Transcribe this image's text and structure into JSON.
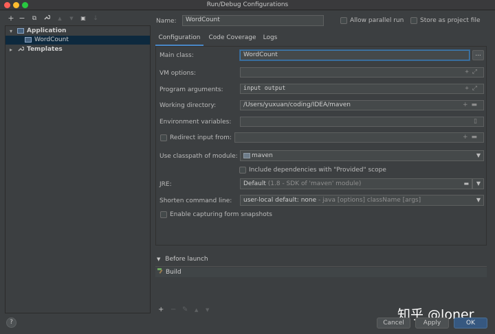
{
  "window": {
    "title": "Run/Debug Configurations"
  },
  "left_toolbar": {
    "add_icon": "+",
    "remove_icon": "−",
    "copy_icon": "⧉",
    "edit_icon": "🔧",
    "up_icon": "▲",
    "down_icon": "▼",
    "folder_icon": "▣",
    "sort_icon": "↓"
  },
  "tree": {
    "items": [
      {
        "label": "Application",
        "expanded": true
      },
      {
        "label": "WordCount",
        "selected": true
      },
      {
        "label": "Templates",
        "expanded": false
      }
    ]
  },
  "header": {
    "name_label": "Name:",
    "name_value": "WordCount",
    "allow_parallel_label": "Allow parallel run",
    "store_as_file_label": "Store as project file"
  },
  "tabs": [
    {
      "label": "Configuration",
      "active": true
    },
    {
      "label": "Code Coverage",
      "active": false
    },
    {
      "label": "Logs",
      "active": false
    }
  ],
  "form": {
    "main_class_label": "Main class:",
    "main_class_value": "WordCount",
    "main_class_button": "...",
    "vm_options_label": "VM options:",
    "vm_options_value": "",
    "program_args_label": "Program arguments:",
    "program_args_value": "input output",
    "working_dir_label": "Working directory:",
    "working_dir_value": "/Users/yuxuan/coding/IDEA/maven",
    "env_vars_label": "Environment variables:",
    "env_vars_value": "",
    "redirect_input_label": "Redirect input from:",
    "redirect_input_value": "",
    "classpath_label": "Use classpath of module:",
    "classpath_value": "maven",
    "include_provided_label": "Include dependencies with \"Provided\" scope",
    "jre_label": "JRE:",
    "jre_value": "Default",
    "jre_detail": "(1.8 - SDK of 'maven' module)",
    "shorten_label": "Shorten command line:",
    "shorten_value": "user-local default: none",
    "shorten_detail": "- java [options] className [args]",
    "snapshots_label": "Enable capturing form snapshots"
  },
  "before_launch": {
    "heading": "Before launch",
    "items": [
      "Build"
    ]
  },
  "buttons": {
    "help": "?",
    "cancel": "Cancel",
    "apply": "Apply",
    "ok": "OK"
  },
  "watermark": "知乎 @loner"
}
